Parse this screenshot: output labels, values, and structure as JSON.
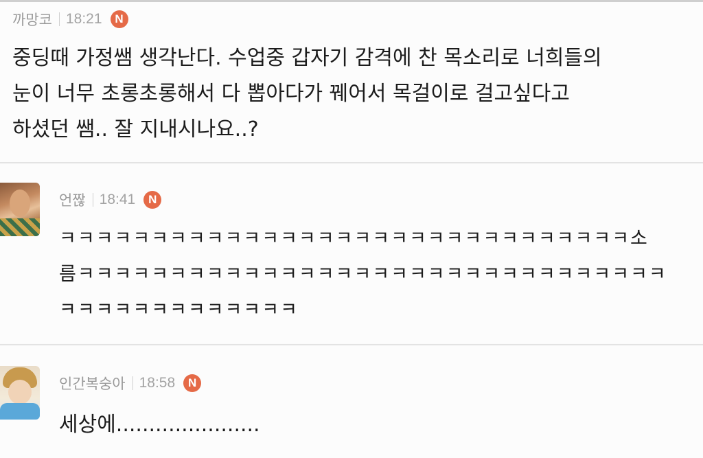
{
  "comments": [
    {
      "author": "까망코",
      "time": "18:21",
      "badge": "N",
      "lines": [
        "중딩때 가정쌤 생각난다. 수업중 갑자기 감격에 찬 목소리로 너희들의",
        "눈이 너무 초롱초롱해서 다 뽑아다가 꿰어서 목걸이로 걸고싶다고",
        "하셨던 쌤.. 잘 지내시나요..?"
      ]
    },
    {
      "author": "언짢",
      "time": "18:41",
      "badge": "N",
      "lines": [
        "ㅋㅋㅋㅋㅋㅋㅋㅋㅋㅋㅋㅋㅋㅋㅋㅋㅋㅋㅋㅋㅋㅋㅋㅋㅋㅋㅋㅋㅋㅋㅋ소",
        "름ㅋㅋㅋㅋㅋㅋㅋㅋㅋㅋㅋㅋㅋㅋㅋㅋㅋㅋㅋㅋㅋㅋㅋㅋㅋㅋㅋㅋㅋㅋㅋㅋ",
        "ㅋㅋㅋㅋㅋㅋㅋㅋㅋㅋㅋㅋㅋ"
      ]
    },
    {
      "author": "인간복숭아",
      "time": "18:58",
      "badge": "N",
      "lines": [
        "세상에......................"
      ]
    }
  ]
}
